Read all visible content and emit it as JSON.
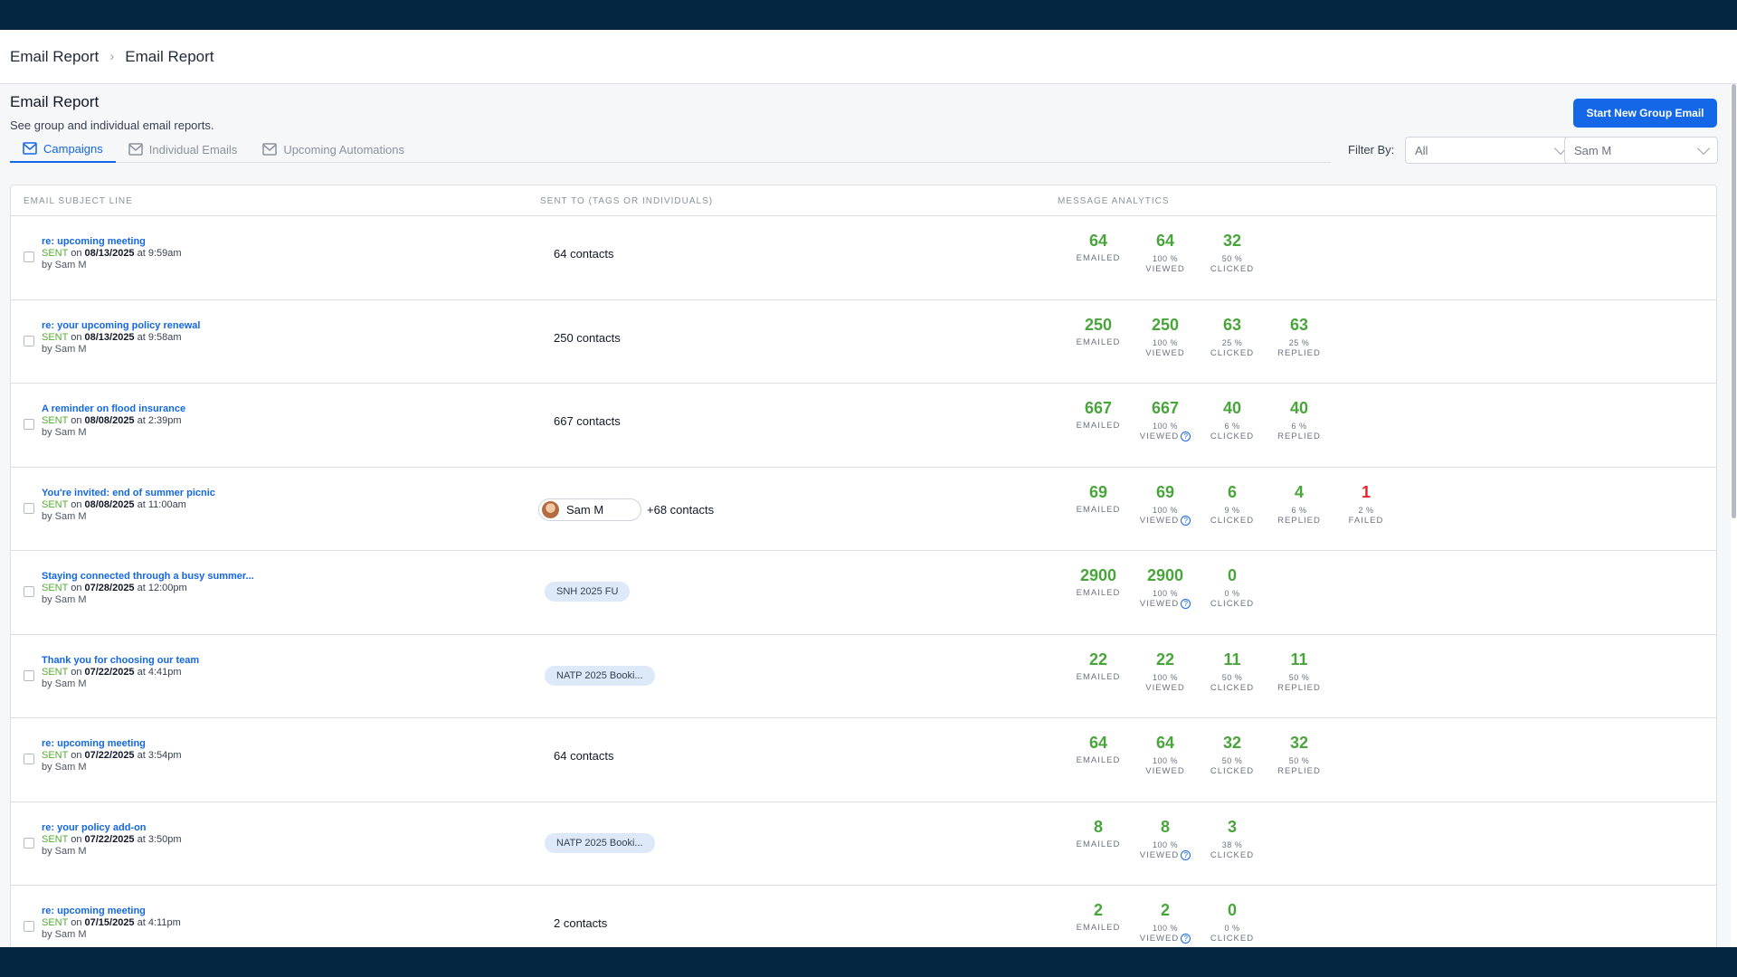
{
  "breadcrumb": [
    "Email Report",
    "Email Report"
  ],
  "header": {
    "title": "Email Report",
    "subtitle": "See group and individual email reports.",
    "start_button": "Start New Group Email"
  },
  "tabs": [
    {
      "label": "Campaigns",
      "icon": "mail-icon",
      "active": true
    },
    {
      "label": "Individual Emails",
      "icon": "mail-icon",
      "active": false
    },
    {
      "label": "Upcoming Automations",
      "icon": "mail-icon",
      "active": false
    }
  ],
  "filter": {
    "label": "Filter By:",
    "type_value": "All",
    "user_value": "Sam M"
  },
  "columns": {
    "subject": "EMAIL SUBJECT LINE",
    "sent_to": "SENT TO (TAGS OR INDIVIDUALS)",
    "analytics": "MESSAGE ANALYTICS"
  },
  "colors": {
    "accent": "#1467e6",
    "metric_green": "#49a53b",
    "failed_red": "#e5252b",
    "sent_green": "#55ac31",
    "header_bg": "#042640"
  },
  "rows": [
    {
      "subject": "re: upcoming meeting",
      "status": "SENT",
      "date": "08/13/2025",
      "time": "at 9:59am",
      "by": "by Sam M",
      "sent_to": {
        "type": "text",
        "text": "64 contacts"
      },
      "metrics": [
        {
          "v": "64",
          "p": "",
          "l": "EMAILED"
        },
        {
          "v": "64",
          "p": "100 %",
          "l": "VIEWED"
        },
        {
          "v": "32",
          "p": "50 %",
          "l": "CLICKED"
        }
      ]
    },
    {
      "subject": "re: your upcoming policy renewal",
      "status": "SENT",
      "date": "08/13/2025",
      "time": "at 9:58am",
      "by": "by Sam M",
      "sent_to": {
        "type": "text",
        "text": "250 contacts"
      },
      "metrics": [
        {
          "v": "250",
          "p": "",
          "l": "EMAILED"
        },
        {
          "v": "250",
          "p": "100 %",
          "l": "VIEWED"
        },
        {
          "v": "63",
          "p": "25 %",
          "l": "CLICKED"
        },
        {
          "v": "63",
          "p": "25 %",
          "l": "REPLIED"
        }
      ]
    },
    {
      "subject": "A reminder on flood insurance",
      "status": "SENT",
      "date": "08/08/2025",
      "time": "at 2:39pm",
      "by": "by Sam M",
      "sent_to": {
        "type": "text",
        "text": "667 contacts"
      },
      "metrics": [
        {
          "v": "667",
          "p": "",
          "l": "EMAILED"
        },
        {
          "v": "667",
          "p": "100 %",
          "l": "VIEWED",
          "q": true
        },
        {
          "v": "40",
          "p": "6 %",
          "l": "CLICKED"
        },
        {
          "v": "40",
          "p": "6 %",
          "l": "REPLIED"
        }
      ]
    },
    {
      "subject": "You're invited: end of summer picnic",
      "status": "SENT",
      "date": "08/08/2025",
      "time": "at 11:00am",
      "by": "by Sam M",
      "sent_to": {
        "type": "person",
        "person": "Sam M",
        "text": "+68 contacts"
      },
      "metrics": [
        {
          "v": "69",
          "p": "",
          "l": "EMAILED"
        },
        {
          "v": "69",
          "p": "100 %",
          "l": "VIEWED",
          "q": true
        },
        {
          "v": "6",
          "p": "9 %",
          "l": "CLICKED"
        },
        {
          "v": "4",
          "p": "6 %",
          "l": "REPLIED"
        },
        {
          "v": "1",
          "p": "2 %",
          "l": "FAILED",
          "red": true
        }
      ]
    },
    {
      "subject": "Staying connected through a busy summer...",
      "status": "SENT",
      "date": "07/28/2025",
      "time": "at 12:00pm",
      "by": "by Sam M",
      "sent_to": {
        "type": "tag",
        "text": "SNH 2025 FU"
      },
      "metrics": [
        {
          "v": "2900",
          "p": "",
          "l": "EMAILED"
        },
        {
          "v": "2900",
          "p": "100 %",
          "l": "VIEWED",
          "q": true
        },
        {
          "v": "0",
          "p": "0 %",
          "l": "CLICKED"
        }
      ]
    },
    {
      "subject": "Thank you for choosing our team",
      "status": "SENT",
      "date": "07/22/2025",
      "time": "at 4:41pm",
      "by": "by Sam M",
      "sent_to": {
        "type": "tag",
        "text": "NATP 2025 Booki..."
      },
      "metrics": [
        {
          "v": "22",
          "p": "",
          "l": "EMAILED"
        },
        {
          "v": "22",
          "p": "100 %",
          "l": "VIEWED"
        },
        {
          "v": "11",
          "p": "50 %",
          "l": "CLICKED"
        },
        {
          "v": "11",
          "p": "50 %",
          "l": "REPLIED"
        }
      ]
    },
    {
      "subject": "re: upcoming meeting",
      "status": "SENT",
      "date": "07/22/2025",
      "time": "at 3:54pm",
      "by": "by Sam M",
      "sent_to": {
        "type": "text",
        "text": "64 contacts"
      },
      "metrics": [
        {
          "v": "64",
          "p": "",
          "l": "EMAILED"
        },
        {
          "v": "64",
          "p": "100 %",
          "l": "VIEWED"
        },
        {
          "v": "32",
          "p": "50 %",
          "l": "CLICKED"
        },
        {
          "v": "32",
          "p": "50 %",
          "l": "REPLIED"
        }
      ]
    },
    {
      "subject": "re: your policy add-on",
      "status": "SENT",
      "date": "07/22/2025",
      "time": "at 3:50pm",
      "by": "by Sam M",
      "sent_to": {
        "type": "tag",
        "text": "NATP 2025 Booki..."
      },
      "metrics": [
        {
          "v": "8",
          "p": "",
          "l": "EMAILED"
        },
        {
          "v": "8",
          "p": "100 %",
          "l": "VIEWED",
          "q": true
        },
        {
          "v": "3",
          "p": "38 %",
          "l": "CLICKED"
        }
      ]
    },
    {
      "subject": "re: upcoming meeting",
      "status": "SENT",
      "date": "07/15/2025",
      "time": "at 4:11pm",
      "by": "by Sam M",
      "sent_to": {
        "type": "text",
        "text": "2 contacts"
      },
      "metrics": [
        {
          "v": "2",
          "p": "",
          "l": "EMAILED"
        },
        {
          "v": "2",
          "p": "100 %",
          "l": "VIEWED",
          "q": true
        },
        {
          "v": "0",
          "p": "0 %",
          "l": "CLICKED"
        }
      ]
    }
  ]
}
